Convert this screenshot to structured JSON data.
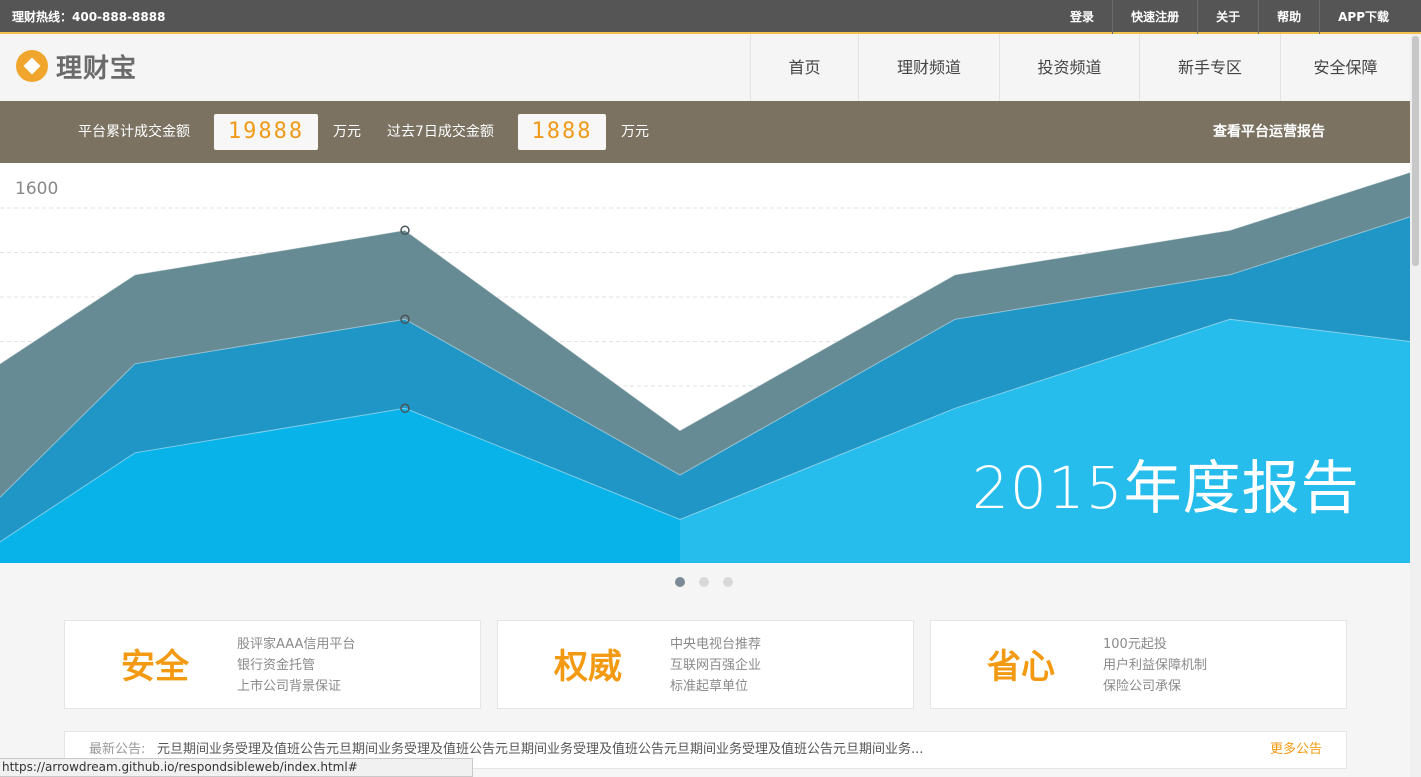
{
  "topbar": {
    "hotline": "理财热线：400-888-8888",
    "links": [
      "登录",
      "快速注册",
      "关于",
      "帮助",
      "APP下载"
    ]
  },
  "header": {
    "logo_text": "理财宝",
    "nav": [
      "首页",
      "理财频道",
      "投资频道",
      "新手专区",
      "安全保障"
    ]
  },
  "stats": {
    "total_label": "平台累计成交金额",
    "total_value": "19888",
    "unit": "万元",
    "week_label": "过去7日成交金额",
    "week_value": "1888",
    "report_link": "查看平台运营报告"
  },
  "banner": {
    "title": "2015年度报告",
    "y_tick": "1600"
  },
  "chart_data": {
    "type": "area",
    "title": "2015年度报告",
    "y_ticks": [
      "1600"
    ],
    "grid": true,
    "x": [
      0,
      1,
      2,
      3,
      4,
      5,
      6
    ],
    "series": [
      {
        "color": "#668b94",
        "values": [
          1250,
          1450,
          1550,
          1100,
          1450,
          1550,
          1680
        ]
      },
      {
        "color": "#2096c6",
        "values": [
          950,
          1250,
          1350,
          1000,
          1350,
          1450,
          1580
        ]
      },
      {
        "color": "#08b3ea",
        "values": [
          850,
          1050,
          1150,
          900,
          1150,
          1350,
          1300
        ]
      }
    ]
  },
  "carousel": {
    "count": 3,
    "active": 0
  },
  "features": [
    {
      "title": "安全",
      "lines": [
        "股评家AAA信用平台",
        "银行资金托管",
        "上市公司背景保证"
      ]
    },
    {
      "title": "权威",
      "lines": [
        "中央电视台推荐",
        "互联网百强企业",
        "标准起草单位"
      ]
    },
    {
      "title": "省心",
      "lines": [
        "100元起投",
        "用户利益保障机制",
        "保险公司承保"
      ]
    }
  ],
  "notice": {
    "label": "最新公告:",
    "text": "元旦期间业务受理及值班公告元旦期间业务受理及值班公告元旦期间业务受理及值班公告元旦期间业务受理及值班公告元旦期间业务...",
    "more": "更多公告"
  },
  "status_url": "https://arrowdream.github.io/respondsibleweb/index.html#"
}
